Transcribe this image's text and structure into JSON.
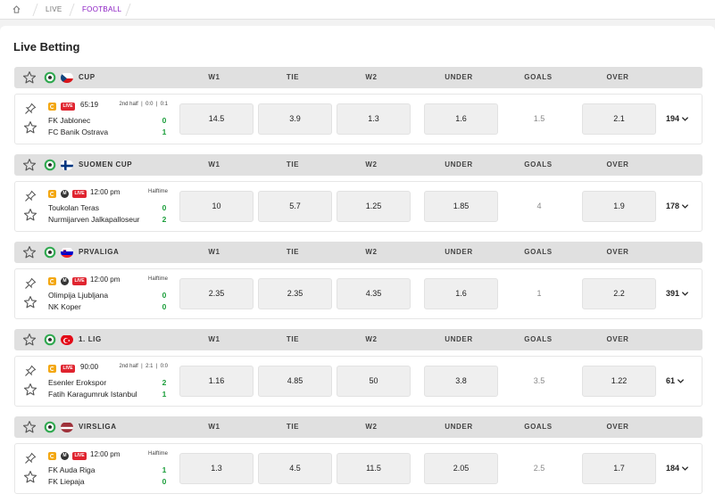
{
  "breadcrumb": {
    "live": "LIVE",
    "football": "FOOTBALL"
  },
  "page": {
    "title": "Live Betting"
  },
  "columns": {
    "w1": "W1",
    "tie": "TIE",
    "w2": "W2",
    "under": "UNDER",
    "goals": "GOALS",
    "over": "OVER"
  },
  "colors": {
    "live_badge": "#e0242f",
    "accent": "#8a1bc2",
    "score": "#1a9e3a",
    "header_bg": "#e0e0e0"
  },
  "leagues": [
    {
      "name": "CUP",
      "flag": "czech-flag",
      "match": {
        "time": "65:19",
        "status": "2nd half",
        "ht": "0:0",
        "ft": "0:1",
        "home": "FK Jablonec",
        "away": "FC Banik Ostrava",
        "home_score": "0",
        "away_score": "1",
        "w1": "14.5",
        "tie": "3.9",
        "w2": "1.3",
        "under": "1.6",
        "goals": "1.5",
        "over": "2.1",
        "more": "194"
      }
    },
    {
      "name": "SUOMEN CUP",
      "flag": "finland-flag",
      "match": {
        "time": "12:00 pm",
        "status": "Halftime",
        "home": "Toukolan Teras",
        "away": "Nurmijarven Jalkapalloseur",
        "home_score": "0",
        "away_score": "2",
        "w1": "10",
        "tie": "5.7",
        "w2": "1.25",
        "under": "1.85",
        "goals": "4",
        "over": "1.9",
        "more": "178"
      }
    },
    {
      "name": "PRVALIGA",
      "flag": "slovenia-flag",
      "match": {
        "time": "12:00 pm",
        "status": "Halftime",
        "home": "Olimpija Ljubljana",
        "away": "NK Koper",
        "home_score": "0",
        "away_score": "0",
        "w1": "2.35",
        "tie": "2.35",
        "w2": "4.35",
        "under": "1.6",
        "goals": "1",
        "over": "2.2",
        "more": "391"
      }
    },
    {
      "name": "1. LIG",
      "flag": "turkey-flag",
      "match": {
        "time": "90:00",
        "status": "2nd half",
        "ht": "2:1",
        "ft": "0:0",
        "home": "Esenler Erokspor",
        "away": "Fatih Karagumruk Istanbul",
        "home_score": "2",
        "away_score": "1",
        "w1": "1.16",
        "tie": "4.85",
        "w2": "50",
        "under": "3.8",
        "goals": "3.5",
        "over": "1.22",
        "more": "61"
      }
    },
    {
      "name": "VIRSLIGA",
      "flag": "latvia-flag",
      "match": {
        "time": "12:00 pm",
        "status": "Halftime",
        "home": "FK Auda Riga",
        "away": "FK Liepaja",
        "home_score": "1",
        "away_score": "0",
        "w1": "1.3",
        "tie": "4.5",
        "w2": "11.5",
        "under": "2.05",
        "goals": "2.5",
        "over": "1.7",
        "more": "184"
      }
    }
  ]
}
